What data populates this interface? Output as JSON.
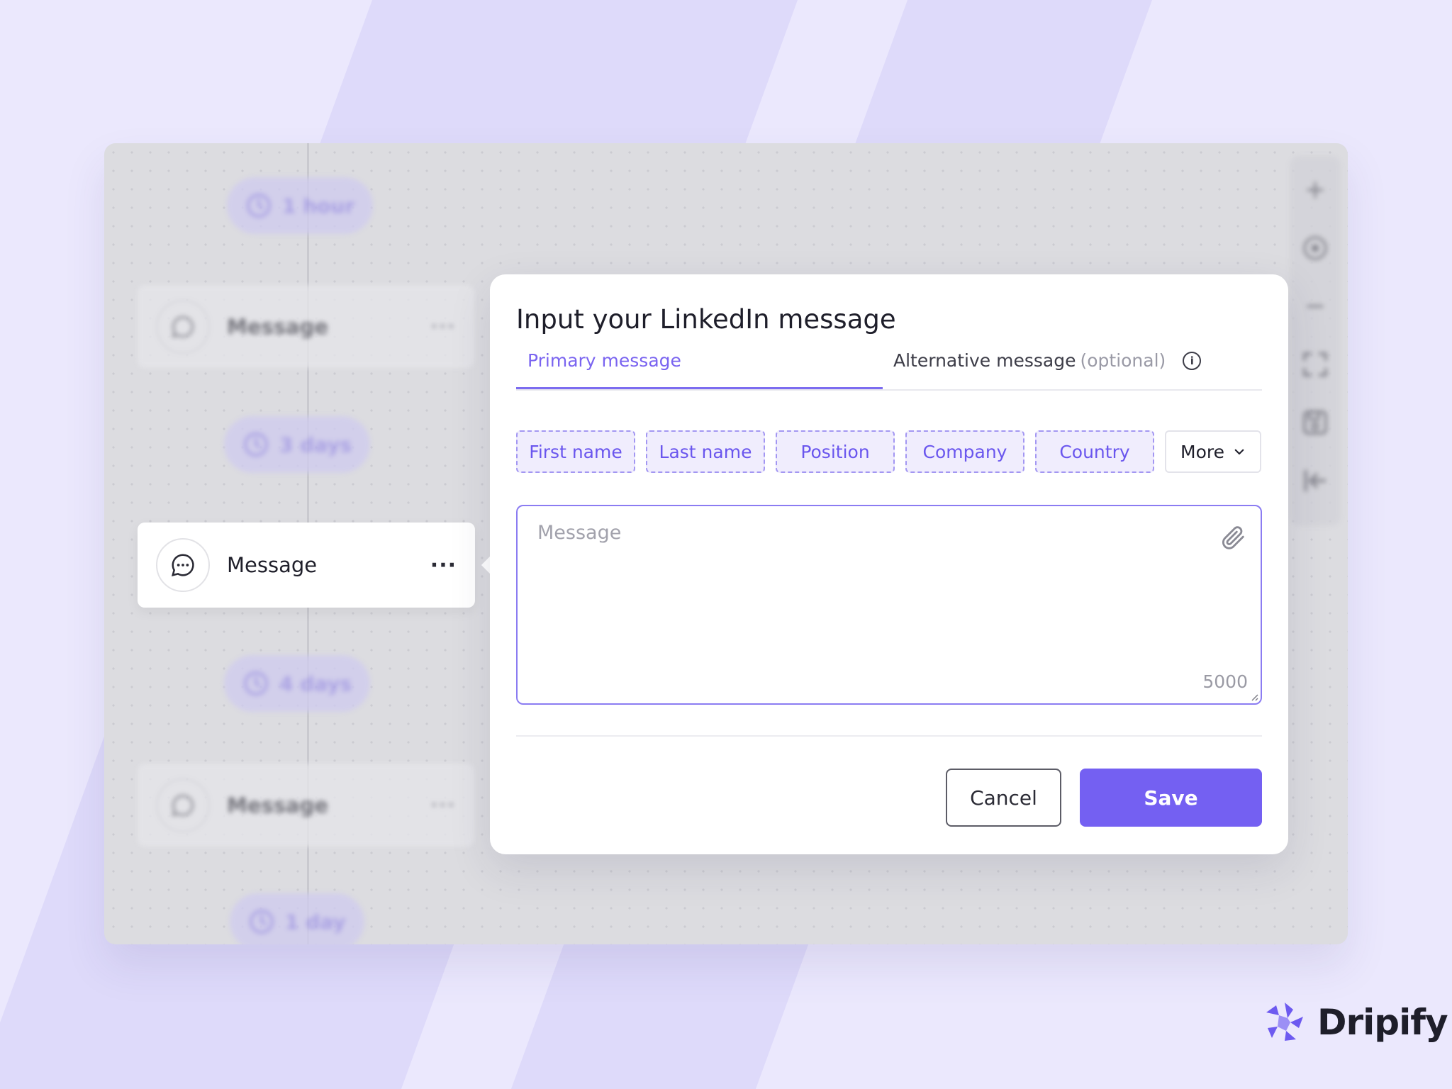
{
  "canvas": {
    "delays": [
      "1 hour",
      "3 days",
      "4 days",
      "1 day"
    ],
    "nodes": {
      "top": {
        "label": "Message",
        "more": "···"
      },
      "active": {
        "label": "Message",
        "more": "···"
      },
      "bottom": {
        "label": "Message",
        "more": "···"
      }
    },
    "toolbar": [
      "plus-icon",
      "target-icon",
      "minus-icon",
      "fit-screen-icon",
      "save-icon",
      "exit-icon"
    ]
  },
  "modal": {
    "title": "Input your LinkedIn message",
    "tabs": {
      "primary": "Primary message",
      "alternative": "Alternative message",
      "alternative_optional": "(optional)"
    },
    "chips": [
      "First name",
      "Last name",
      "Position",
      "Company",
      "Country"
    ],
    "more_label": "More",
    "message": {
      "placeholder": "Message",
      "value": "",
      "counter": "5000"
    },
    "cancel_label": "Cancel",
    "save_label": "Save"
  },
  "brand": {
    "name": "Dripify"
  },
  "colors": {
    "accent": "#7460f2",
    "chip_text": "#6a56ee",
    "background": "#ebe8fd"
  }
}
